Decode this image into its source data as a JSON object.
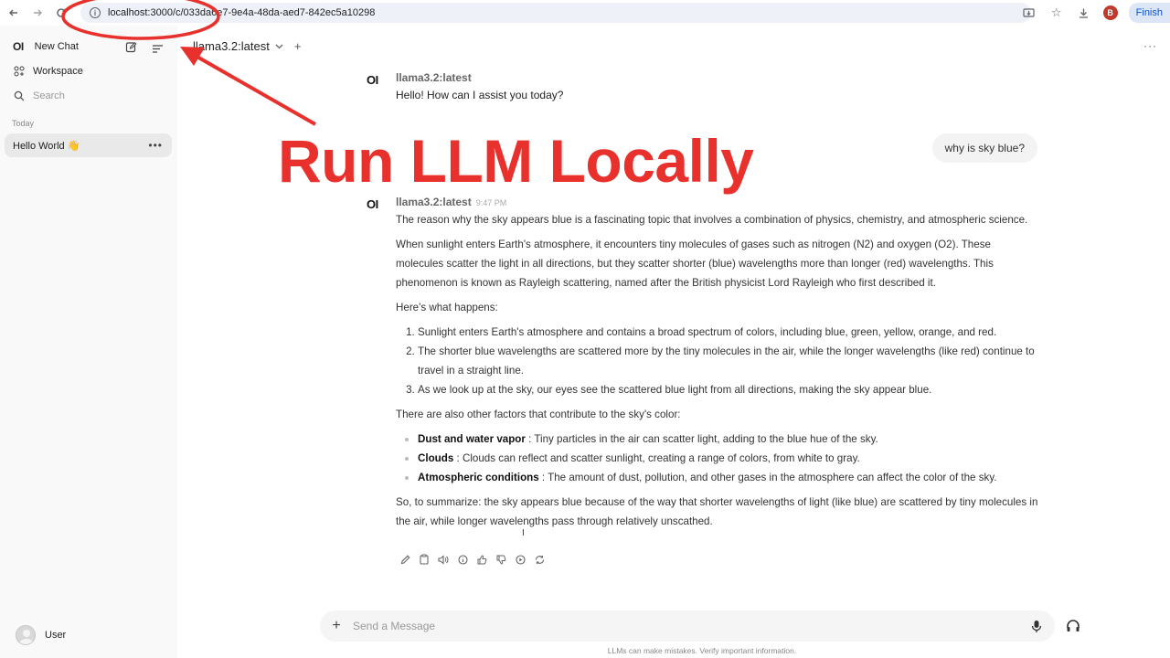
{
  "browser": {
    "url": "localhost:3000/c/033da6e7-9e4a-48da-aed7-842ec5a10298",
    "profile_initial": "B",
    "finish_label": "Finish"
  },
  "sidebar": {
    "logo": "OI",
    "new_chat": "New Chat",
    "workspace": "Workspace",
    "search": "Search",
    "section_today": "Today",
    "chat_item": "Hello World 👋",
    "user": "User"
  },
  "header": {
    "model": "llama3.2:latest"
  },
  "messages": {
    "logo": "OI",
    "first": {
      "model": "llama3.2:latest",
      "text": "Hello! How can I assist you today?"
    },
    "user": {
      "text": "why is sky blue?"
    },
    "second": {
      "model": "llama3.2:latest",
      "time": "9:47 PM",
      "p1": "The reason why the sky appears blue is a fascinating topic that involves a combination of physics, chemistry, and atmospheric science.",
      "p2": "When sunlight enters Earth's atmosphere, it encounters tiny molecules of gases such as nitrogen (N2) and oxygen (O2). These molecules scatter the light in all directions, but they scatter shorter (blue) wavelengths more than longer (red) wavelengths. This phenomenon is known as Rayleigh scattering, named after the British physicist Lord Rayleigh who first described it.",
      "p3": "Here's what happens:",
      "steps": [
        "Sunlight enters Earth's atmosphere and contains a broad spectrum of colors, including blue, green, yellow, orange, and red.",
        "The shorter blue wavelengths are scattered more by the tiny molecules in the air, while the longer wavelengths (like red) continue to travel in a straight line.",
        "As we look up at the sky, our eyes see the scattered blue light from all directions, making the sky appear blue."
      ],
      "p4": "There are also other factors that contribute to the sky's color:",
      "factors": [
        {
          "term": "Dust and water vapor",
          "desc": " : Tiny particles in the air can scatter light, adding to the blue hue of the sky."
        },
        {
          "term": "Clouds",
          "desc": " : Clouds can reflect and scatter sunlight, creating a range of colors, from white to gray."
        },
        {
          "term": "Atmospheric conditions",
          "desc": " : The amount of dust, pollution, and other gases in the atmosphere can affect the color of the sky."
        }
      ],
      "p5": "So, to summarize: the sky appears blue because of the way that shorter wavelengths of light (like blue) are scattered by tiny molecules in the air, while longer wavelengths pass through relatively unscathed."
    }
  },
  "composer": {
    "placeholder": "Send a Message"
  },
  "footnote": "LLMs can make mistakes. Verify important information.",
  "overlay": {
    "title": "Run LLM Locally",
    "color": "#e8302c"
  },
  "icons": {
    "back": "arrow-left-icon",
    "forward": "arrow-right-icon",
    "reload": "reload-icon",
    "edit": "edit-icon",
    "menu": "menu-icon",
    "mic": "mic-icon",
    "headset": "headset-icon"
  }
}
